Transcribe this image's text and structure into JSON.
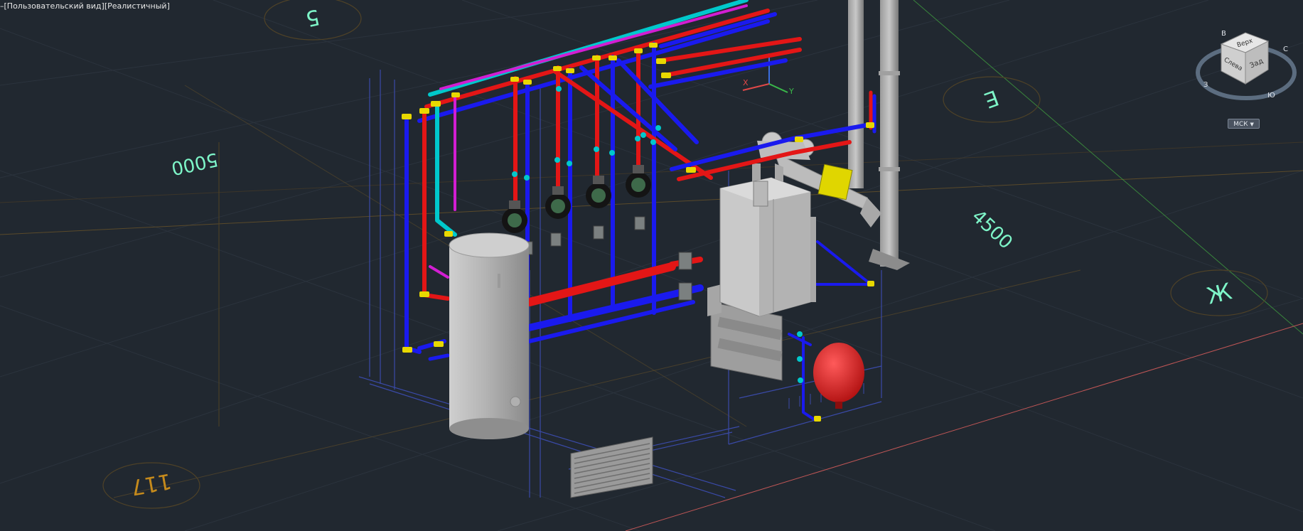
{
  "viewport": {
    "controls": {
      "minus": "–",
      "view": "[Пользовательский вид]",
      "style": "[Реалистичный]"
    }
  },
  "viewcube": {
    "top": "Верх",
    "left": "Слева",
    "back": "Зад",
    "compass": {
      "north": "С",
      "west": "З",
      "south": "Ю",
      "east": "В"
    },
    "ucs_menu": "МСК"
  },
  "grid_markers": {
    "axis_5": "5",
    "axis_E": "Е",
    "axis_Zh": "Ж",
    "room": "117"
  },
  "dimensions": {
    "dim_5000": "5000",
    "dim_4500": "4500"
  },
  "colors": {
    "background": "#212830",
    "supply_pipe": "#e31616",
    "return_pipe": "#1a1aee",
    "dhw_pipe": "#00c8cc",
    "recirc_pipe": "#d21ed2",
    "fitting": "#e8d800",
    "axis_text": "#7ef5c8",
    "room_text": "#c58a1c",
    "equipment": "#b8b8b8",
    "expansion_tank": "#d81818"
  }
}
